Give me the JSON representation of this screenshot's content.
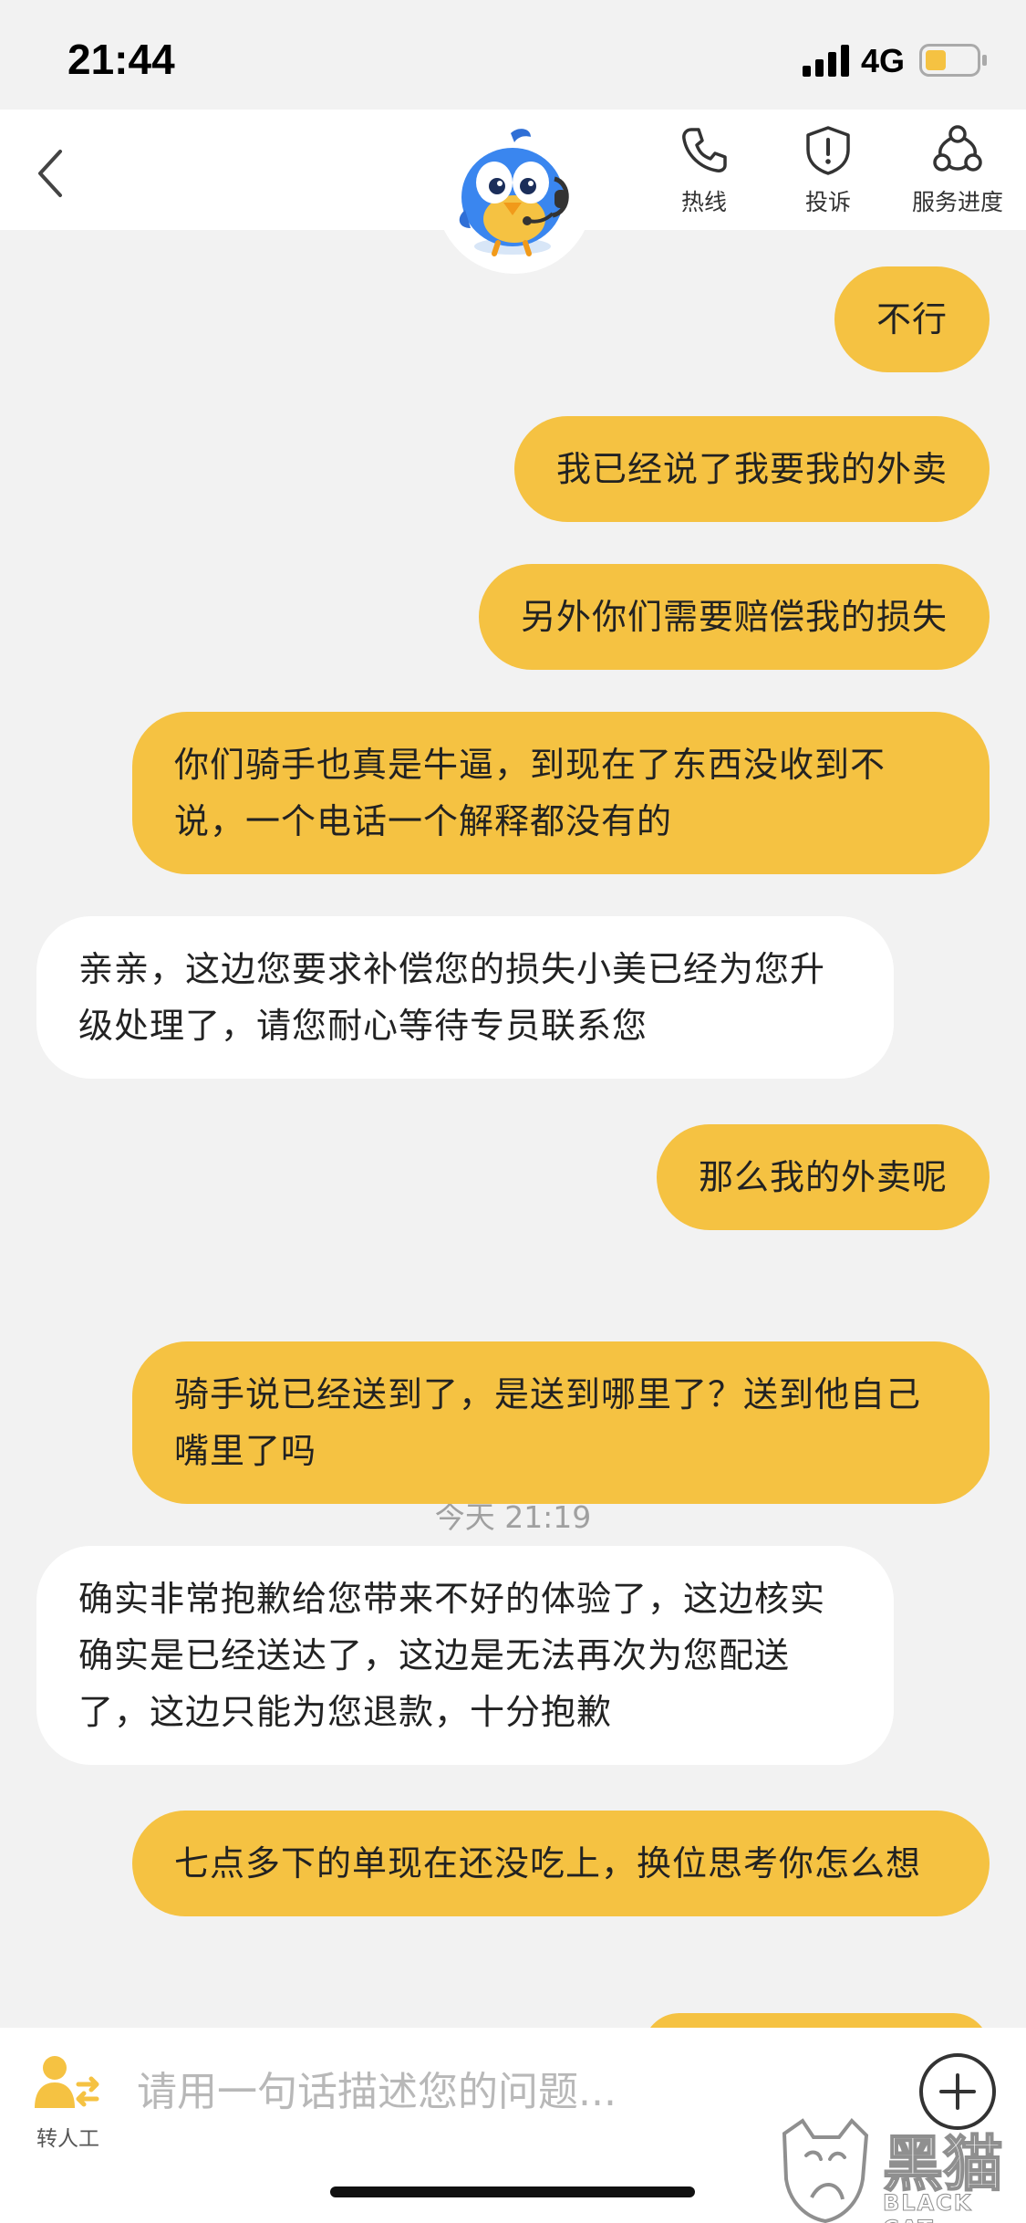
{
  "status_bar": {
    "time": "21:44",
    "network": "4G",
    "icons": [
      "signal-icon",
      "battery-icon"
    ],
    "battery_color": "#f5c242"
  },
  "nav": {
    "back_icon": "chevron-left-icon",
    "mascot_icon": "support-bird-mascot-icon",
    "actions": [
      {
        "label": "热线",
        "icon": "phone-icon"
      },
      {
        "label": "投诉",
        "icon": "shield-alert-icon"
      },
      {
        "label": "服务进度",
        "icon": "progress-nodes-icon"
      }
    ]
  },
  "chat": {
    "messages": [
      {
        "from": "user",
        "text": "不行"
      },
      {
        "from": "user",
        "text": "我已经说了我要我的外卖"
      },
      {
        "from": "user",
        "text": "另外你们需要赔偿我的损失"
      },
      {
        "from": "user",
        "text": "你们骑手也真是牛逼，到现在了东西没收到不说，一个电话一个解释都没有的"
      },
      {
        "from": "agent",
        "text": "亲亲，这边您要求补偿您的损失小美已经为您升级处理了，请您耐心等待专员联系您"
      },
      {
        "from": "user",
        "text": "那么我的外卖呢"
      },
      {
        "from": "user",
        "text": "骑手说已经送到了，是送到哪里了？送到他自己嘴里了吗"
      },
      {
        "from": "agent",
        "text": "确实非常抱歉给您带来不好的体验了，这边核实确实是已经送达了，这边是无法再次为您配送了，这边只能为您退款，十分抱歉"
      },
      {
        "from": "user",
        "text": "七点多下的单现在还没吃上，换位思考你怎么想"
      }
    ],
    "timestamp": "今天 21:19",
    "colors": {
      "user_bubble": "#f5c242",
      "agent_bubble": "#ffffff",
      "background": "#f2f2f2"
    }
  },
  "input_bar": {
    "transfer_label": "转人工",
    "transfer_icon": "person-transfer-icon",
    "placeholder": "请用一句话描述您的问题...",
    "plus_icon": "plus-circle-icon"
  },
  "watermark": {
    "text_cn": "黑猫",
    "text_en": "BLACK CAT"
  }
}
